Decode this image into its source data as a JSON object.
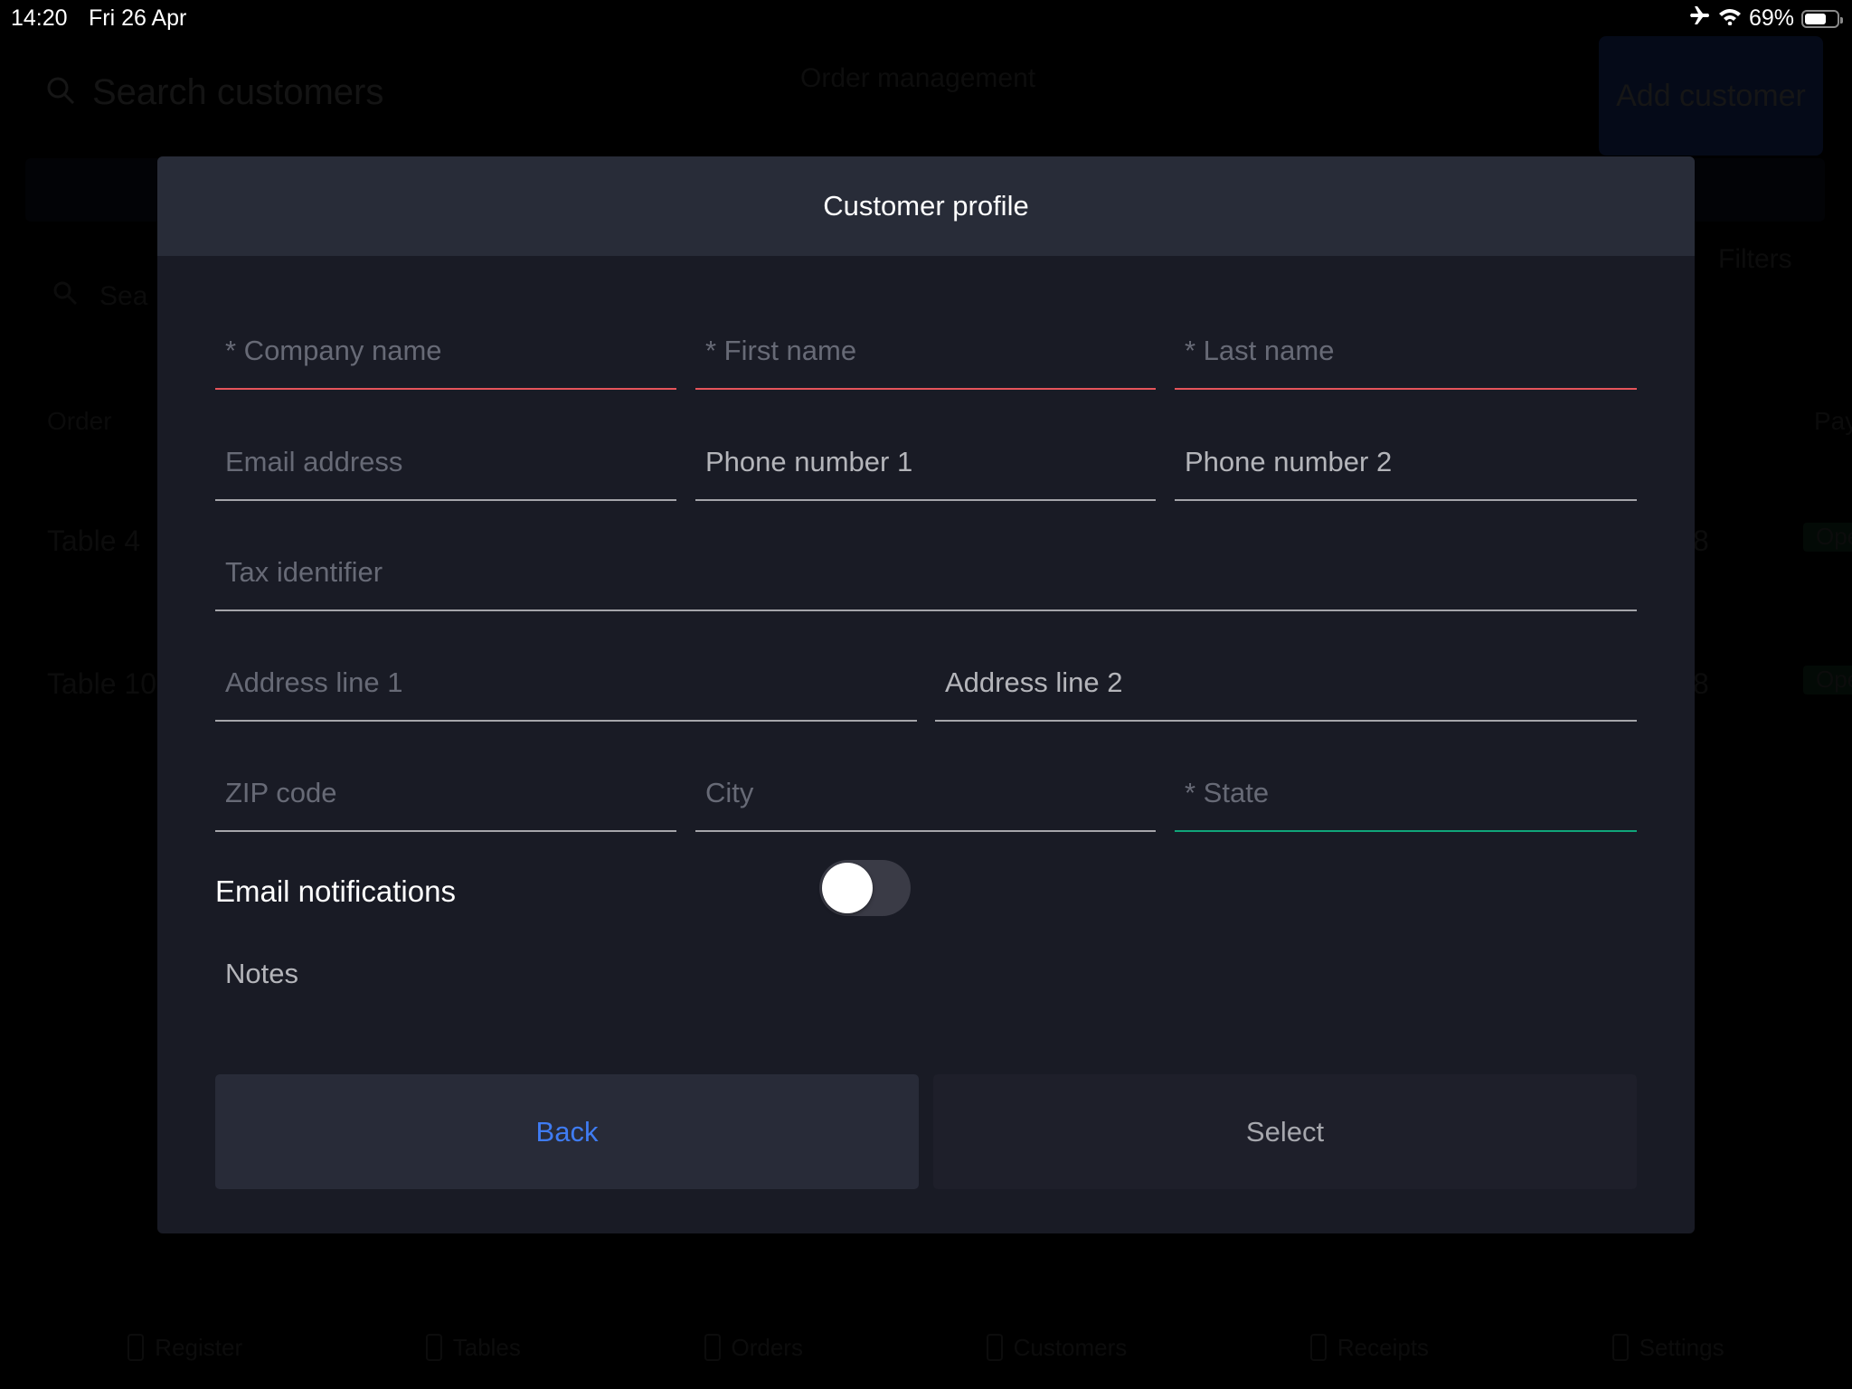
{
  "status_bar": {
    "time": "14:20",
    "date": "Fri 26 Apr",
    "airplane_icon": "airplane-icon",
    "wifi_icon": "wifi-icon",
    "battery_percent": "69%",
    "battery_level": 0.69
  },
  "background": {
    "search_placeholder": "Search customers",
    "title": "Order management",
    "add_customer_label": "Add customer",
    "sub_search_label": "Sea",
    "filters_label": "Filters",
    "column_order": "Order",
    "column_pay": "Pay",
    "rows": [
      {
        "label": "Table 4",
        "value": "8",
        "status": "Ope"
      },
      {
        "label": "Table 10",
        "value": "8",
        "status": "Ope"
      }
    ],
    "tabs": [
      {
        "label": "Register",
        "icon": "register-icon"
      },
      {
        "label": "Tables",
        "icon": "tables-icon"
      },
      {
        "label": "Orders",
        "icon": "orders-icon"
      },
      {
        "label": "Customers",
        "icon": "customers-icon"
      },
      {
        "label": "Receipts",
        "icon": "receipts-icon"
      },
      {
        "label": "Settings",
        "icon": "settings-icon"
      }
    ]
  },
  "modal": {
    "title": "Customer profile",
    "fields": {
      "company_name": {
        "placeholder": "* Company name",
        "value": "",
        "required": true
      },
      "first_name": {
        "placeholder": "* First name",
        "value": "",
        "required": true
      },
      "last_name": {
        "placeholder": "* Last name",
        "value": "",
        "required": true
      },
      "email": {
        "placeholder": "Email address",
        "value": ""
      },
      "phone1": {
        "placeholder": "Phone number 1",
        "value": ""
      },
      "phone2": {
        "placeholder": "Phone number 2",
        "value": ""
      },
      "tax_id": {
        "placeholder": "Tax identifier",
        "value": ""
      },
      "address1": {
        "placeholder": "Address line 1",
        "value": ""
      },
      "address2": {
        "placeholder": "Address line 2",
        "value": ""
      },
      "zip": {
        "placeholder": "ZIP code",
        "value": ""
      },
      "city": {
        "placeholder": "City",
        "value": ""
      },
      "state": {
        "placeholder": "* State",
        "value": "",
        "required": true,
        "focused": true
      }
    },
    "email_notifications": {
      "label": "Email notifications",
      "enabled": false
    },
    "notes": {
      "placeholder": "Notes",
      "value": ""
    },
    "buttons": {
      "back": "Back",
      "select": "Select"
    },
    "colors": {
      "required_underline": "#e5545a",
      "focused_underline": "#10a57a",
      "back_text": "#3f7cf3"
    }
  }
}
